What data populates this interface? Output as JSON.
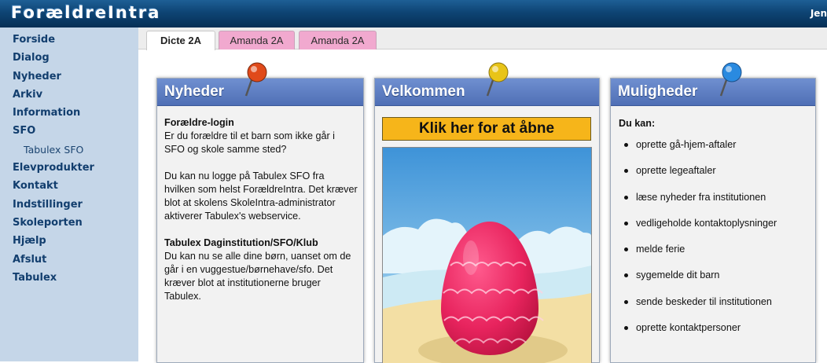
{
  "header": {
    "app_title": "ForældreIntra",
    "user_name": "Jen"
  },
  "sidebar": {
    "items": [
      {
        "label": "Forside",
        "sub": false
      },
      {
        "label": "Dialog",
        "sub": false
      },
      {
        "label": "Nyheder",
        "sub": false
      },
      {
        "label": "Arkiv",
        "sub": false
      },
      {
        "label": "Information",
        "sub": false
      },
      {
        "label": "SFO",
        "sub": false
      },
      {
        "label": "Tabulex SFO",
        "sub": true
      },
      {
        "label": "Elevprodukter",
        "sub": false
      },
      {
        "label": "Kontakt",
        "sub": false
      },
      {
        "label": "Indstillinger",
        "sub": false
      },
      {
        "label": "Skoleporten",
        "sub": false
      },
      {
        "label": "Hjælp",
        "sub": false
      },
      {
        "label": "Afslut",
        "sub": false
      },
      {
        "label": "Tabulex",
        "sub": false
      }
    ]
  },
  "tabs": [
    {
      "label": "Dicte 2A",
      "active": true
    },
    {
      "label": "Amanda 2A",
      "active": false
    },
    {
      "label": "Amanda 2A",
      "active": false
    }
  ],
  "panels": {
    "news": {
      "title": "Nyheder",
      "pin_color": "#e04a1a",
      "block1_heading": "Forældre-login",
      "block1_text": "Er du forældre til et barn som ikke går i SFO og skole samme sted?",
      "block2_text": "Du kan nu logge på Tabulex SFO fra hvilken som helst ForældreIntra. Det kræver blot at skolens SkoleIntra-administrator aktiverer Tabulex's webservice.",
      "block3_heading": "Tabulex Daginstitution/SFO/Klub",
      "block3_text": "Du kan nu se alle dine børn, uanset om de går i en vuggestue/børnehave/sfo. Det kræver blot at institutionerne bruger Tabulex."
    },
    "welcome": {
      "title": "Velkommen",
      "pin_color": "#e8c418",
      "button_label": "Klik her for at åbne",
      "image_icon": "easter-egg-image"
    },
    "options": {
      "title": "Muligheder",
      "pin_color": "#2a8ae0",
      "intro": "Du kan:",
      "items": [
        "oprette gå-hjem-aftaler",
        "oprette legeaftaler",
        "læse nyheder fra institutionen",
        "vedligeholde kontaktoplysninger",
        "melde ferie",
        "sygemelde dit barn",
        "sende beskeder til institutionen",
        "oprette kontaktpersoner"
      ]
    }
  },
  "colors": {
    "header_bg": "#0e4474",
    "sidebar_bg": "#c5d6e8",
    "tab_inactive": "#f1a9cf",
    "panel_header": "#5a7bc0",
    "button_bg": "#f6b51a",
    "egg": "#e8245e"
  }
}
